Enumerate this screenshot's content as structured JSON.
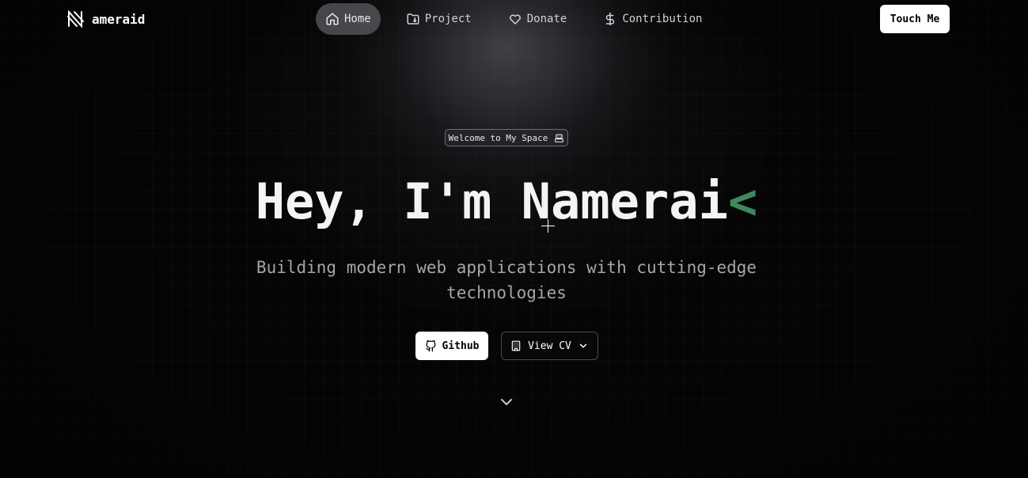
{
  "brand": {
    "name": "ameraid",
    "logo_icon": "slashed-n-logo"
  },
  "nav": {
    "items": [
      {
        "label": "Home",
        "icon": "home-icon",
        "active": true
      },
      {
        "label": "Project",
        "icon": "folder-icon",
        "active": false
      },
      {
        "label": "Donate",
        "icon": "heart-icon",
        "active": false
      },
      {
        "label": "Contribution",
        "icon": "dollar-icon",
        "active": false
      }
    ],
    "cta_label": "Touch Me"
  },
  "hero": {
    "badge_text": "Welcome to My Space",
    "badge_icon": "bot-icon",
    "headline": "Hey, I'm Namerai",
    "headline_cursor": "<",
    "subtitle": "Building modern web applications with cutting-edge technologies",
    "github_label": "Github",
    "cv_label": "View CV",
    "scroll_icon": "chevron-down-icon"
  },
  "colors": {
    "accent": "#3e8a5e",
    "background": "#050505",
    "active_nav_bg": "#5a5c62"
  }
}
